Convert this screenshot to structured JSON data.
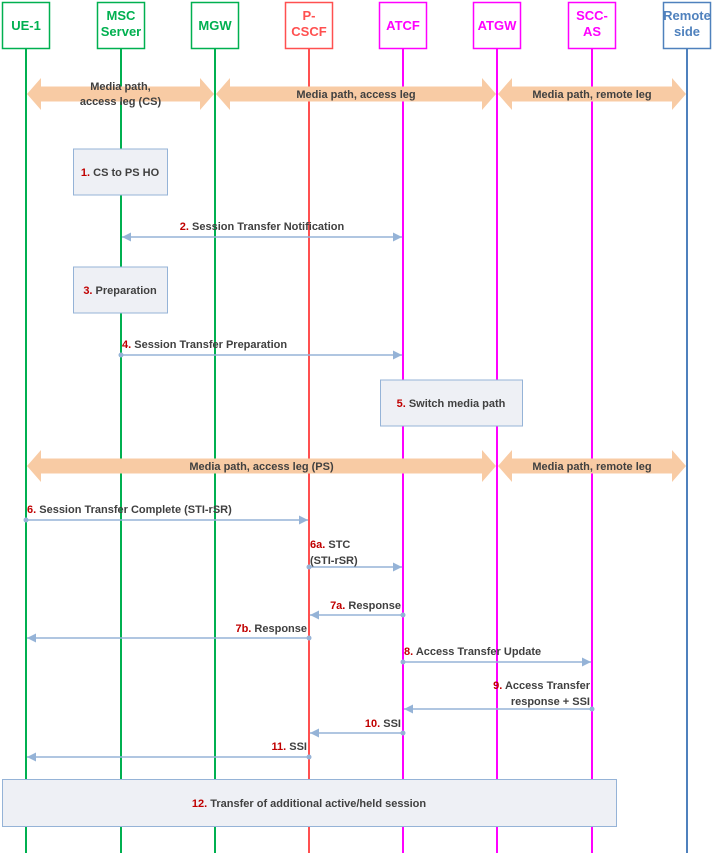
{
  "diagram": {
    "type": "sequence-diagram",
    "colors": {
      "green": "#00b050",
      "red": "#ff5050",
      "magenta": "#ff00ff",
      "blue": "#4f81bd",
      "media_band": "#f8cba4",
      "message_arrow": "#95b3d7",
      "step_number": "#c00000",
      "box_fill": "#eef0f5",
      "box_border": "#95b3d7",
      "text": "#404040"
    },
    "participants": [
      {
        "id": "ue1",
        "label_lines": [
          "UE-1"
        ],
        "color": "#00b050"
      },
      {
        "id": "msc",
        "label_lines": [
          "MSC",
          "Server"
        ],
        "color": "#00b050"
      },
      {
        "id": "mgw",
        "label_lines": [
          "MGW"
        ],
        "color": "#00b050"
      },
      {
        "id": "pcscf",
        "label_lines": [
          "P-",
          "CSCF"
        ],
        "color": "#ff5050"
      },
      {
        "id": "atcf",
        "label_lines": [
          "ATCF"
        ],
        "color": "#ff00ff"
      },
      {
        "id": "atgw",
        "label_lines": [
          "ATGW"
        ],
        "color": "#ff00ff"
      },
      {
        "id": "sccas",
        "label_lines": [
          "SCC-",
          "AS"
        ],
        "color": "#ff00ff"
      },
      {
        "id": "remote",
        "label_lines": [
          "Remote",
          "side"
        ],
        "color": "#4f81bd"
      }
    ],
    "media_paths": [
      {
        "id": "mp1",
        "from": "ue1",
        "to": "mgw",
        "row": 1,
        "label_lines": [
          "Media path,",
          "access leg (CS)"
        ]
      },
      {
        "id": "mp2",
        "from": "mgw",
        "to": "atgw",
        "row": 1,
        "label_lines": [
          "Media path, access leg"
        ]
      },
      {
        "id": "mp3",
        "from": "atgw",
        "to": "remote",
        "row": 1,
        "label_lines": [
          "Media path, remote leg"
        ]
      },
      {
        "id": "mp4",
        "from": "ue1",
        "to": "atgw",
        "row": 2,
        "label_lines": [
          "Media path, access leg (PS)"
        ]
      },
      {
        "id": "mp5",
        "from": "atgw",
        "to": "remote",
        "row": 2,
        "label_lines": [
          "Media path, remote leg"
        ]
      }
    ],
    "steps": [
      {
        "kind": "box",
        "num": "1.",
        "text": "CS to PS HO",
        "over": "msc"
      },
      {
        "kind": "message",
        "num": "2.",
        "text": "Session Transfer Notification",
        "from": "msc",
        "to": "atcf",
        "bidirectional": true
      },
      {
        "kind": "box",
        "num": "3.",
        "text": "Preparation",
        "over": "msc"
      },
      {
        "kind": "message",
        "num": "4.",
        "text": "Session Transfer Preparation",
        "from": "msc",
        "to": "atcf"
      },
      {
        "kind": "box",
        "num": "5.",
        "text": "Switch media path",
        "over": "atcf-atgw"
      },
      {
        "kind": "message",
        "num": "6.",
        "text": "Session Transfer Complete (STI-rSR)",
        "from": "ue1",
        "to": "pcscf"
      },
      {
        "kind": "message",
        "num": "6a.",
        "text_lines": [
          "STC",
          "(STI-rSR)"
        ],
        "from": "pcscf",
        "to": "atcf"
      },
      {
        "kind": "message",
        "num": "7a.",
        "text": "Response",
        "from": "atcf",
        "to": "pcscf"
      },
      {
        "kind": "message",
        "num": "7b.",
        "text": "Response",
        "from": "pcscf",
        "to": "ue1"
      },
      {
        "kind": "message",
        "num": "8.",
        "text": "Access Transfer Update",
        "from": "atcf",
        "to": "sccas"
      },
      {
        "kind": "message",
        "num": "9.",
        "text_lines": [
          "Access Transfer",
          "response + SSI"
        ],
        "from": "sccas",
        "to": "atcf"
      },
      {
        "kind": "message",
        "num": "10.",
        "text": "SSI",
        "from": "atcf",
        "to": "pcscf"
      },
      {
        "kind": "message",
        "num": "11.",
        "text": "SSI",
        "from": "pcscf",
        "to": "ue1"
      },
      {
        "kind": "box",
        "num": "12.",
        "text": "Transfer of additional active/held session",
        "over": "ue1-sccas"
      }
    ]
  }
}
